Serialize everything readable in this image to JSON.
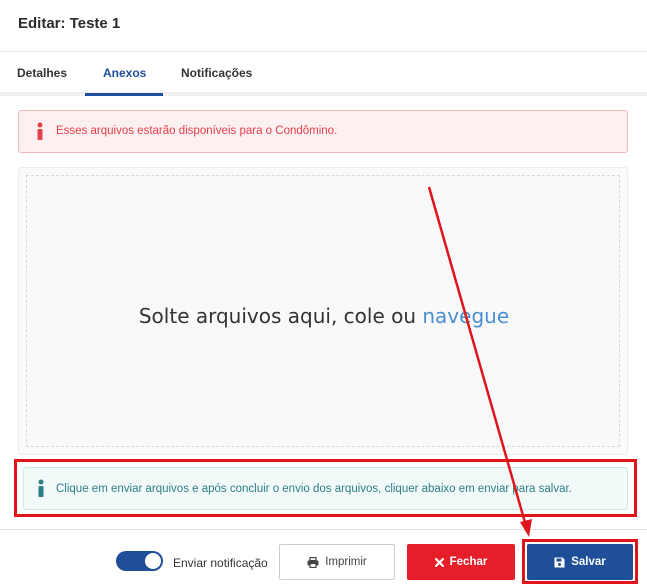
{
  "header": {
    "title": "Editar: Teste 1"
  },
  "tabs": [
    {
      "label": "Detalhes"
    },
    {
      "label": "Anexos"
    },
    {
      "label": "Notificações"
    }
  ],
  "active_tab": "Anexos",
  "alert_warning": {
    "text": "Esses arquivos estarão disponíveis para o Condômino.",
    "icon": "info-icon",
    "color": "#e2404b"
  },
  "dropzone": {
    "text": "Solte arquivos aqui, cole ou ",
    "link": "navegue"
  },
  "alert_info": {
    "text": "Clique em enviar arquivos e após concluir o envio dos arquivos, cliquer abaixo em enviar para salvar.",
    "icon": "info-icon",
    "color": "#2f7d87"
  },
  "footer": {
    "notify_toggle": {
      "label": "Enviar notificação",
      "on": true
    },
    "print_label": "Imprimir",
    "close_label": "Fechar",
    "save_label": "Salvar"
  },
  "colors": {
    "primary": "#1e4f98",
    "danger": "#e51e2a",
    "annotation": "#e0141b"
  }
}
